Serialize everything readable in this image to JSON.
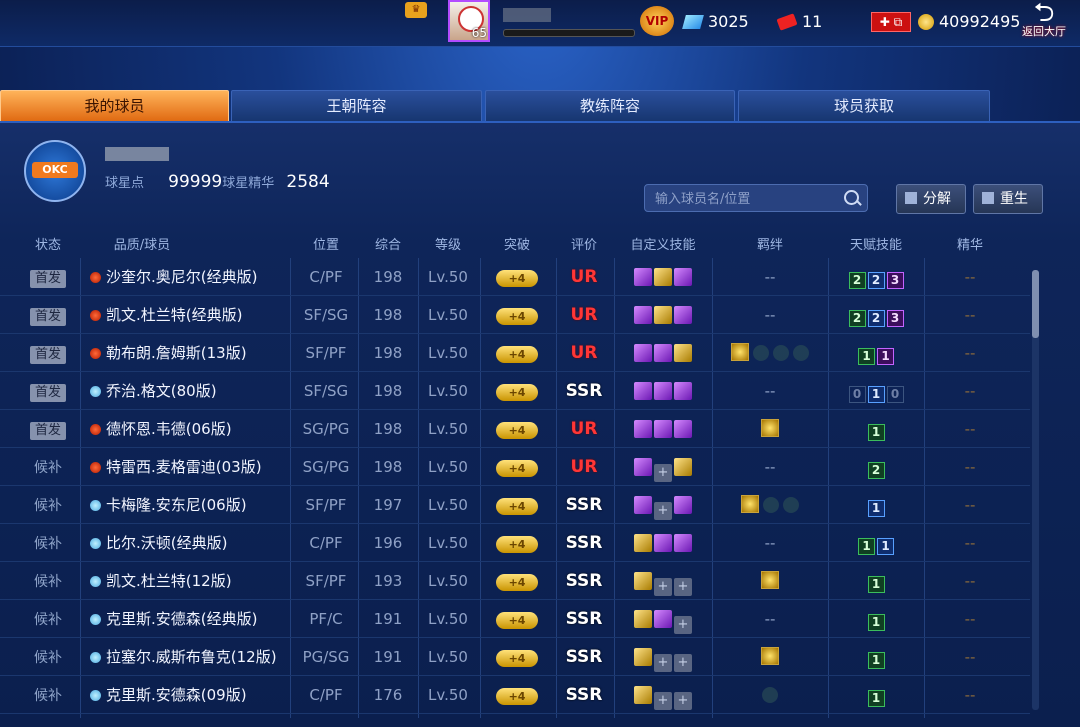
{
  "top": {
    "level": "65",
    "diamonds": "3025",
    "tickets": "11",
    "gold": "40992495",
    "back_label": "返回大厅",
    "vip_label": "VIP"
  },
  "tabs": [
    "我的球员",
    "王朝阵容",
    "教练阵容",
    "球员获取"
  ],
  "profile": {
    "star_points_label": "球星点",
    "star_points": "99999",
    "essence_label": "球星精华",
    "essence": "2584",
    "team_logo_text": "OKC"
  },
  "search": {
    "placeholder": "输入球员名/位置"
  },
  "buttons": {
    "decompose": "分解",
    "rebirth": "重生"
  },
  "columns": [
    "状态",
    "品质/球员",
    "位置",
    "综合",
    "等级",
    "突破",
    "评价",
    "自定义技能",
    "羁绊",
    "天赋技能",
    "精华"
  ],
  "players": [
    {
      "status": "首发",
      "starter": true,
      "quality": "red",
      "name": "沙奎尔.奥尼尔(经典版)",
      "pos": "C/PF",
      "ovr": "198",
      "lv": "Lv.50",
      "brk": "+4",
      "rate": "UR",
      "skills": [
        "p",
        "g",
        "p"
      ],
      "bonds": [],
      "talents": [
        [
          "gr",
          "2"
        ],
        [
          "bl",
          "2"
        ],
        [
          "pu",
          "3"
        ]
      ],
      "essence": "--"
    },
    {
      "status": "首发",
      "starter": true,
      "quality": "red",
      "name": "凯文.杜兰特(经典版)",
      "pos": "SF/SG",
      "ovr": "198",
      "lv": "Lv.50",
      "brk": "+4",
      "rate": "UR",
      "skills": [
        "p",
        "g",
        "p"
      ],
      "bonds": [],
      "talents": [
        [
          "gr",
          "2"
        ],
        [
          "bl",
          "2"
        ],
        [
          "pu",
          "3"
        ]
      ],
      "essence": "--"
    },
    {
      "status": "首发",
      "starter": true,
      "quality": "red",
      "name": "勒布朗.詹姆斯(13版)",
      "pos": "SF/PF",
      "ovr": "198",
      "lv": "Lv.50",
      "brk": "+4",
      "rate": "UR",
      "skills": [
        "p",
        "p",
        "g"
      ],
      "bonds": [
        "g",
        "x",
        "x",
        "x"
      ],
      "talents": [
        [
          "gr",
          "1"
        ],
        [
          "pu",
          "1"
        ]
      ],
      "essence": "--"
    },
    {
      "status": "首发",
      "starter": true,
      "quality": "blue",
      "name": "乔治.格文(80版)",
      "pos": "SF/SG",
      "ovr": "198",
      "lv": "Lv.50",
      "brk": "+4",
      "rate": "SSR",
      "skills": [
        "p",
        "p",
        "p"
      ],
      "bonds": [],
      "talents": [
        [
          "dim",
          "0"
        ],
        [
          "bl",
          "1"
        ],
        [
          "dim",
          "0"
        ]
      ],
      "essence": "--"
    },
    {
      "status": "首发",
      "starter": true,
      "quality": "red",
      "name": "德怀恩.韦德(06版)",
      "pos": "SG/PG",
      "ovr": "198",
      "lv": "Lv.50",
      "brk": "+4",
      "rate": "UR",
      "skills": [
        "p",
        "p",
        "p"
      ],
      "bonds": [
        "g"
      ],
      "talents": [
        [
          "gr",
          "1"
        ]
      ],
      "essence": "--"
    },
    {
      "status": "候补",
      "starter": false,
      "quality": "red",
      "name": "特雷西.麦格雷迪(03版)",
      "pos": "SG/PG",
      "ovr": "198",
      "lv": "Lv.50",
      "brk": "+4",
      "rate": "UR",
      "skills": [
        "p",
        "e",
        "g"
      ],
      "bonds": [],
      "talents": [
        [
          "gr",
          "2"
        ]
      ],
      "essence": "--"
    },
    {
      "status": "候补",
      "starter": false,
      "quality": "blue",
      "name": "卡梅隆.安东尼(06版)",
      "pos": "SF/PF",
      "ovr": "197",
      "lv": "Lv.50",
      "brk": "+4",
      "rate": "SSR",
      "skills": [
        "p",
        "e",
        "p"
      ],
      "bonds": [
        "g",
        "x",
        "x"
      ],
      "talents": [
        [
          "bl",
          "1"
        ]
      ],
      "essence": "--"
    },
    {
      "status": "候补",
      "starter": false,
      "quality": "blue",
      "name": "比尔.沃顿(经典版)",
      "pos": "C/PF",
      "ovr": "196",
      "lv": "Lv.50",
      "brk": "+4",
      "rate": "SSR",
      "skills": [
        "g",
        "p",
        "p"
      ],
      "bonds": [],
      "talents": [
        [
          "gr",
          "1"
        ],
        [
          "bl",
          "1"
        ]
      ],
      "essence": "--"
    },
    {
      "status": "候补",
      "starter": false,
      "quality": "blue",
      "name": "凯文.杜兰特(12版)",
      "pos": "SF/PF",
      "ovr": "193",
      "lv": "Lv.50",
      "brk": "+4",
      "rate": "SSR",
      "skills": [
        "g",
        "e",
        "e"
      ],
      "bonds": [
        "g"
      ],
      "talents": [
        [
          "gr",
          "1"
        ]
      ],
      "essence": "--"
    },
    {
      "status": "候补",
      "starter": false,
      "quality": "blue",
      "name": "克里斯.安德森(经典版)",
      "pos": "PF/C",
      "ovr": "191",
      "lv": "Lv.50",
      "brk": "+4",
      "rate": "SSR",
      "skills": [
        "g",
        "p",
        "e"
      ],
      "bonds": [],
      "talents": [
        [
          "gr",
          "1"
        ]
      ],
      "essence": "--"
    },
    {
      "status": "候补",
      "starter": false,
      "quality": "blue",
      "name": "拉塞尔.威斯布鲁克(12版)",
      "pos": "PG/SG",
      "ovr": "191",
      "lv": "Lv.50",
      "brk": "+4",
      "rate": "SSR",
      "skills": [
        "g",
        "e",
        "e"
      ],
      "bonds": [
        "g"
      ],
      "talents": [
        [
          "gr",
          "1"
        ]
      ],
      "essence": "--"
    },
    {
      "status": "候补",
      "starter": false,
      "quality": "blue",
      "name": "克里斯.安德森(09版)",
      "pos": "C/PF",
      "ovr": "176",
      "lv": "Lv.50",
      "brk": "+4",
      "rate": "SSR",
      "skills": [
        "g",
        "e",
        "e"
      ],
      "bonds": [
        "x"
      ],
      "talents": [
        [
          "gr",
          "1"
        ]
      ],
      "essence": "--"
    }
  ]
}
